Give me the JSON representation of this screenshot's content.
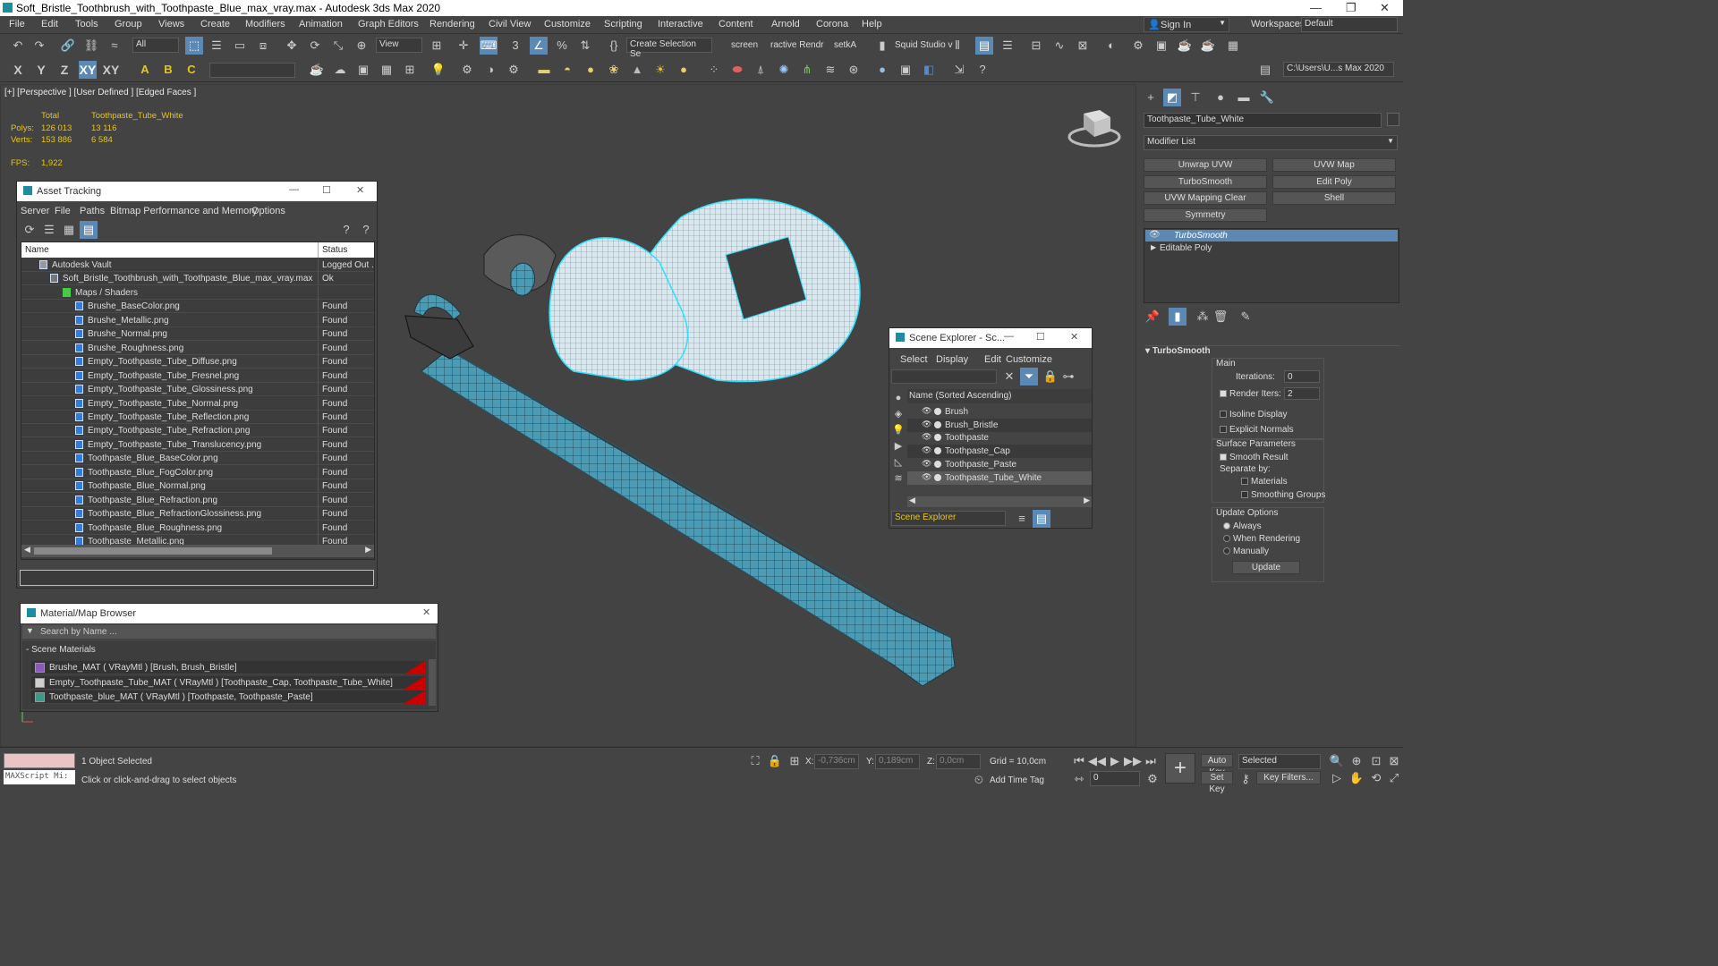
{
  "window": {
    "title": "Soft_Bristle_Toothbrush_with_Toothpaste_Blue_max_vray.max - Autodesk 3ds Max 2020"
  },
  "menu": [
    "File",
    "Edit",
    "Tools",
    "Group",
    "Views",
    "Create",
    "Modifiers",
    "Animation",
    "Graph Editors",
    "Rendering",
    "Civil View",
    "Customize",
    "Scripting",
    "Interactive",
    "Content",
    "Arnold",
    "Corona",
    "Help"
  ],
  "account": {
    "sign_in": "Sign In",
    "workspaces_label": "Workspaces:",
    "workspace": "Default"
  },
  "toolbar": {
    "filter": "All",
    "view": "View",
    "selection_set": "Create Selection Se",
    "screen": "screen",
    "interactive": "ractive Rendr",
    "setka": "setkA",
    "squid": "Squid Studio v",
    "axes": [
      "X",
      "Y",
      "Z",
      "XY",
      "XY"
    ],
    "path": "C:\\Users\\U...s Max 2020"
  },
  "viewport": {
    "label": "[+] [Perspective ] [User Defined ] [Edged Faces ]",
    "stats": {
      "total": "Total",
      "object": "Toothpaste_Tube_White",
      "polys_label": "Polys:",
      "polys_total": "126 013",
      "polys_obj": "13 116",
      "verts_label": "Verts:",
      "verts_total": "153 886",
      "verts_obj": "6 584",
      "fps_label": "FPS:",
      "fps": "1,922"
    }
  },
  "asset_tracking": {
    "title": "Asset Tracking",
    "menu": [
      "Server",
      "File",
      "Paths",
      "Bitmap Performance and Memory",
      "Options"
    ],
    "col_name": "Name",
    "col_status": "Status",
    "rows": [
      {
        "name": "Autodesk Vault",
        "status": "Logged Out ..."
      },
      {
        "name": "Soft_Bristle_Toothbrush_with_Toothpaste_Blue_max_vray.max",
        "status": "Ok"
      },
      {
        "name": "Maps / Shaders",
        "status": ""
      },
      {
        "name": "Brushe_BaseColor.png",
        "status": "Found"
      },
      {
        "name": "Brushe_Metallic.png",
        "status": "Found"
      },
      {
        "name": "Brushe_Normal.png",
        "status": "Found"
      },
      {
        "name": "Brushe_Roughness.png",
        "status": "Found"
      },
      {
        "name": "Empty_Toothpaste_Tube_Diffuse.png",
        "status": "Found"
      },
      {
        "name": "Empty_Toothpaste_Tube_Fresnel.png",
        "status": "Found"
      },
      {
        "name": "Empty_Toothpaste_Tube_Glossiness.png",
        "status": "Found"
      },
      {
        "name": "Empty_Toothpaste_Tube_Normal.png",
        "status": "Found"
      },
      {
        "name": "Empty_Toothpaste_Tube_Reflection.png",
        "status": "Found"
      },
      {
        "name": "Empty_Toothpaste_Tube_Refraction.png",
        "status": "Found"
      },
      {
        "name": "Empty_Toothpaste_Tube_Translucency.png",
        "status": "Found"
      },
      {
        "name": "Toothpaste_Blue_BaseColor.png",
        "status": "Found"
      },
      {
        "name": "Toothpaste_Blue_FogColor.png",
        "status": "Found"
      },
      {
        "name": "Toothpaste_Blue_Normal.png",
        "status": "Found"
      },
      {
        "name": "Toothpaste_Blue_Refraction.png",
        "status": "Found"
      },
      {
        "name": "Toothpaste_Blue_RefractionGlossiness.png",
        "status": "Found"
      },
      {
        "name": "Toothpaste_Blue_Roughness.png",
        "status": "Found"
      },
      {
        "name": "Toothpaste_Metallic.png",
        "status": "Found"
      }
    ]
  },
  "material_browser": {
    "title": "Material/Map Browser",
    "search_placeholder": "Search by Name ...",
    "section": "- Scene Materials",
    "items": [
      "Brushe_MAT  ( VRayMtl )  [Brush, Brush_Bristle]",
      "Empty_Toothpaste_Tube_MAT  ( VRayMtl )  [Toothpaste_Cap, Toothpaste_Tube_White]",
      "Toothpaste_blue_MAT  ( VRayMtl )  [Toothpaste, Toothpaste_Paste]"
    ]
  },
  "scene_explorer": {
    "title": "Scene Explorer - Sc...",
    "menu": [
      "Select",
      "Display",
      "Edit",
      "Customize"
    ],
    "column": "Name (Sorted Ascending)",
    "items": [
      "Brush",
      "Brush_Bristle",
      "Toothpaste",
      "Toothpaste_Cap",
      "Toothpaste_Paste",
      "Toothpaste_Tube_White"
    ],
    "footer": "Scene Explorer"
  },
  "command_panel": {
    "object_name": "Toothpaste_Tube_White",
    "modifier_list": "Modifier List",
    "buttons": [
      "Unwrap UVW",
      "UVW Map",
      "TurboSmooth",
      "Edit Poly",
      "UVW Mapping Clear",
      "Shell",
      "Symmetry"
    ],
    "stack": [
      "TurboSmooth",
      "Editable Poly"
    ],
    "rollout": {
      "title": "TurboSmooth",
      "main": "Main",
      "iterations_label": "Iterations:",
      "iterations": "0",
      "render_iters_label": "Render Iters:",
      "render_iters": "2",
      "isoline": "Isoline Display",
      "explicit": "Explicit Normals",
      "surface": "Surface Parameters",
      "smooth_result": "Smooth Result",
      "separate_by": "Separate by:",
      "materials": "Materials",
      "smoothing_groups": "Smoothing Groups",
      "update_options": "Update Options",
      "always": "Always",
      "when_rendering": "When Rendering",
      "manually": "Manually",
      "update": "Update"
    }
  },
  "status": {
    "maxscript": "MAXScript Mi:",
    "selected": "1 Object Selected",
    "hint": "Click or click-and-drag to select objects",
    "x_label": "X:",
    "x": "-0,736cm",
    "y_label": "Y:",
    "y": "0,189cm",
    "z_label": "Z:",
    "z": "0,0cm",
    "grid": "Grid = 10,0cm",
    "add_time_tag": "Add Time Tag",
    "auto_key": "Auto Key",
    "set_key": "Set Key",
    "selected_dd": "Selected",
    "key_filters": "Key Filters...",
    "frame": "0"
  }
}
